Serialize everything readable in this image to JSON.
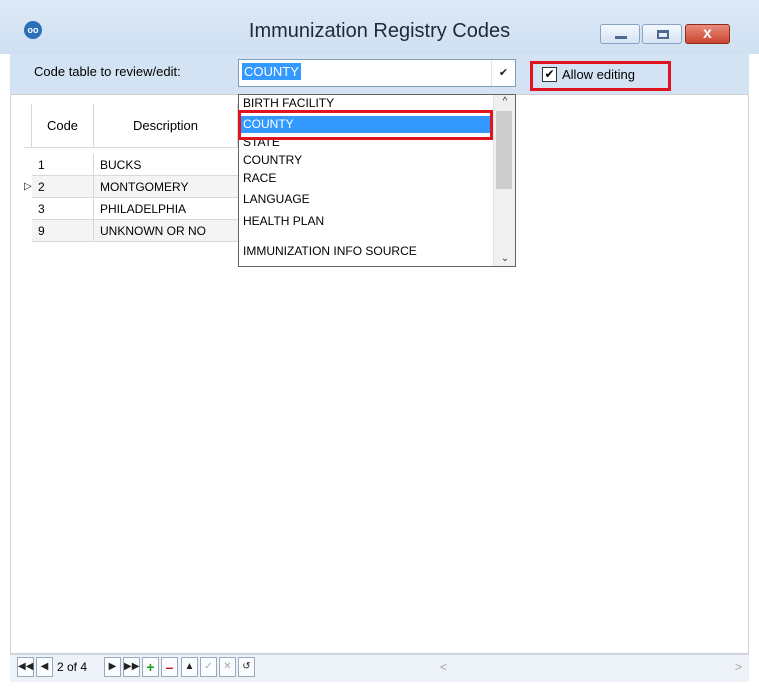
{
  "window": {
    "title": "Immunization Registry Codes",
    "app_icon": "oo",
    "close_glyph": "x"
  },
  "toolbar": {
    "code_label": "Code table to review/edit:",
    "selected_table": "COUNTY",
    "allow_editing_label": "Allow editing",
    "allow_editing_checked": true
  },
  "grid": {
    "columns": [
      "Code",
      "Description"
    ],
    "rows": [
      {
        "code": "1",
        "description": "BUCKS"
      },
      {
        "code": "2",
        "description": "MONTGOMERY"
      },
      {
        "code": "3",
        "description": "PHILADELPHIA"
      },
      {
        "code": "9",
        "description": "UNKNOWN OR NO"
      }
    ],
    "current_row_index": 1
  },
  "dropdown": {
    "options": [
      "BIRTH FACILITY",
      "COUNTY",
      "STATE",
      "COUNTRY",
      "RACE",
      "LANGUAGE",
      "HEALTH PLAN",
      "IMMUNIZATION INFO SOURCE"
    ],
    "selected_index": 1
  },
  "navigator": {
    "position_text": "2 of 4"
  },
  "colors": {
    "highlight_box": "#e0141e",
    "selection": "#3399ff"
  }
}
